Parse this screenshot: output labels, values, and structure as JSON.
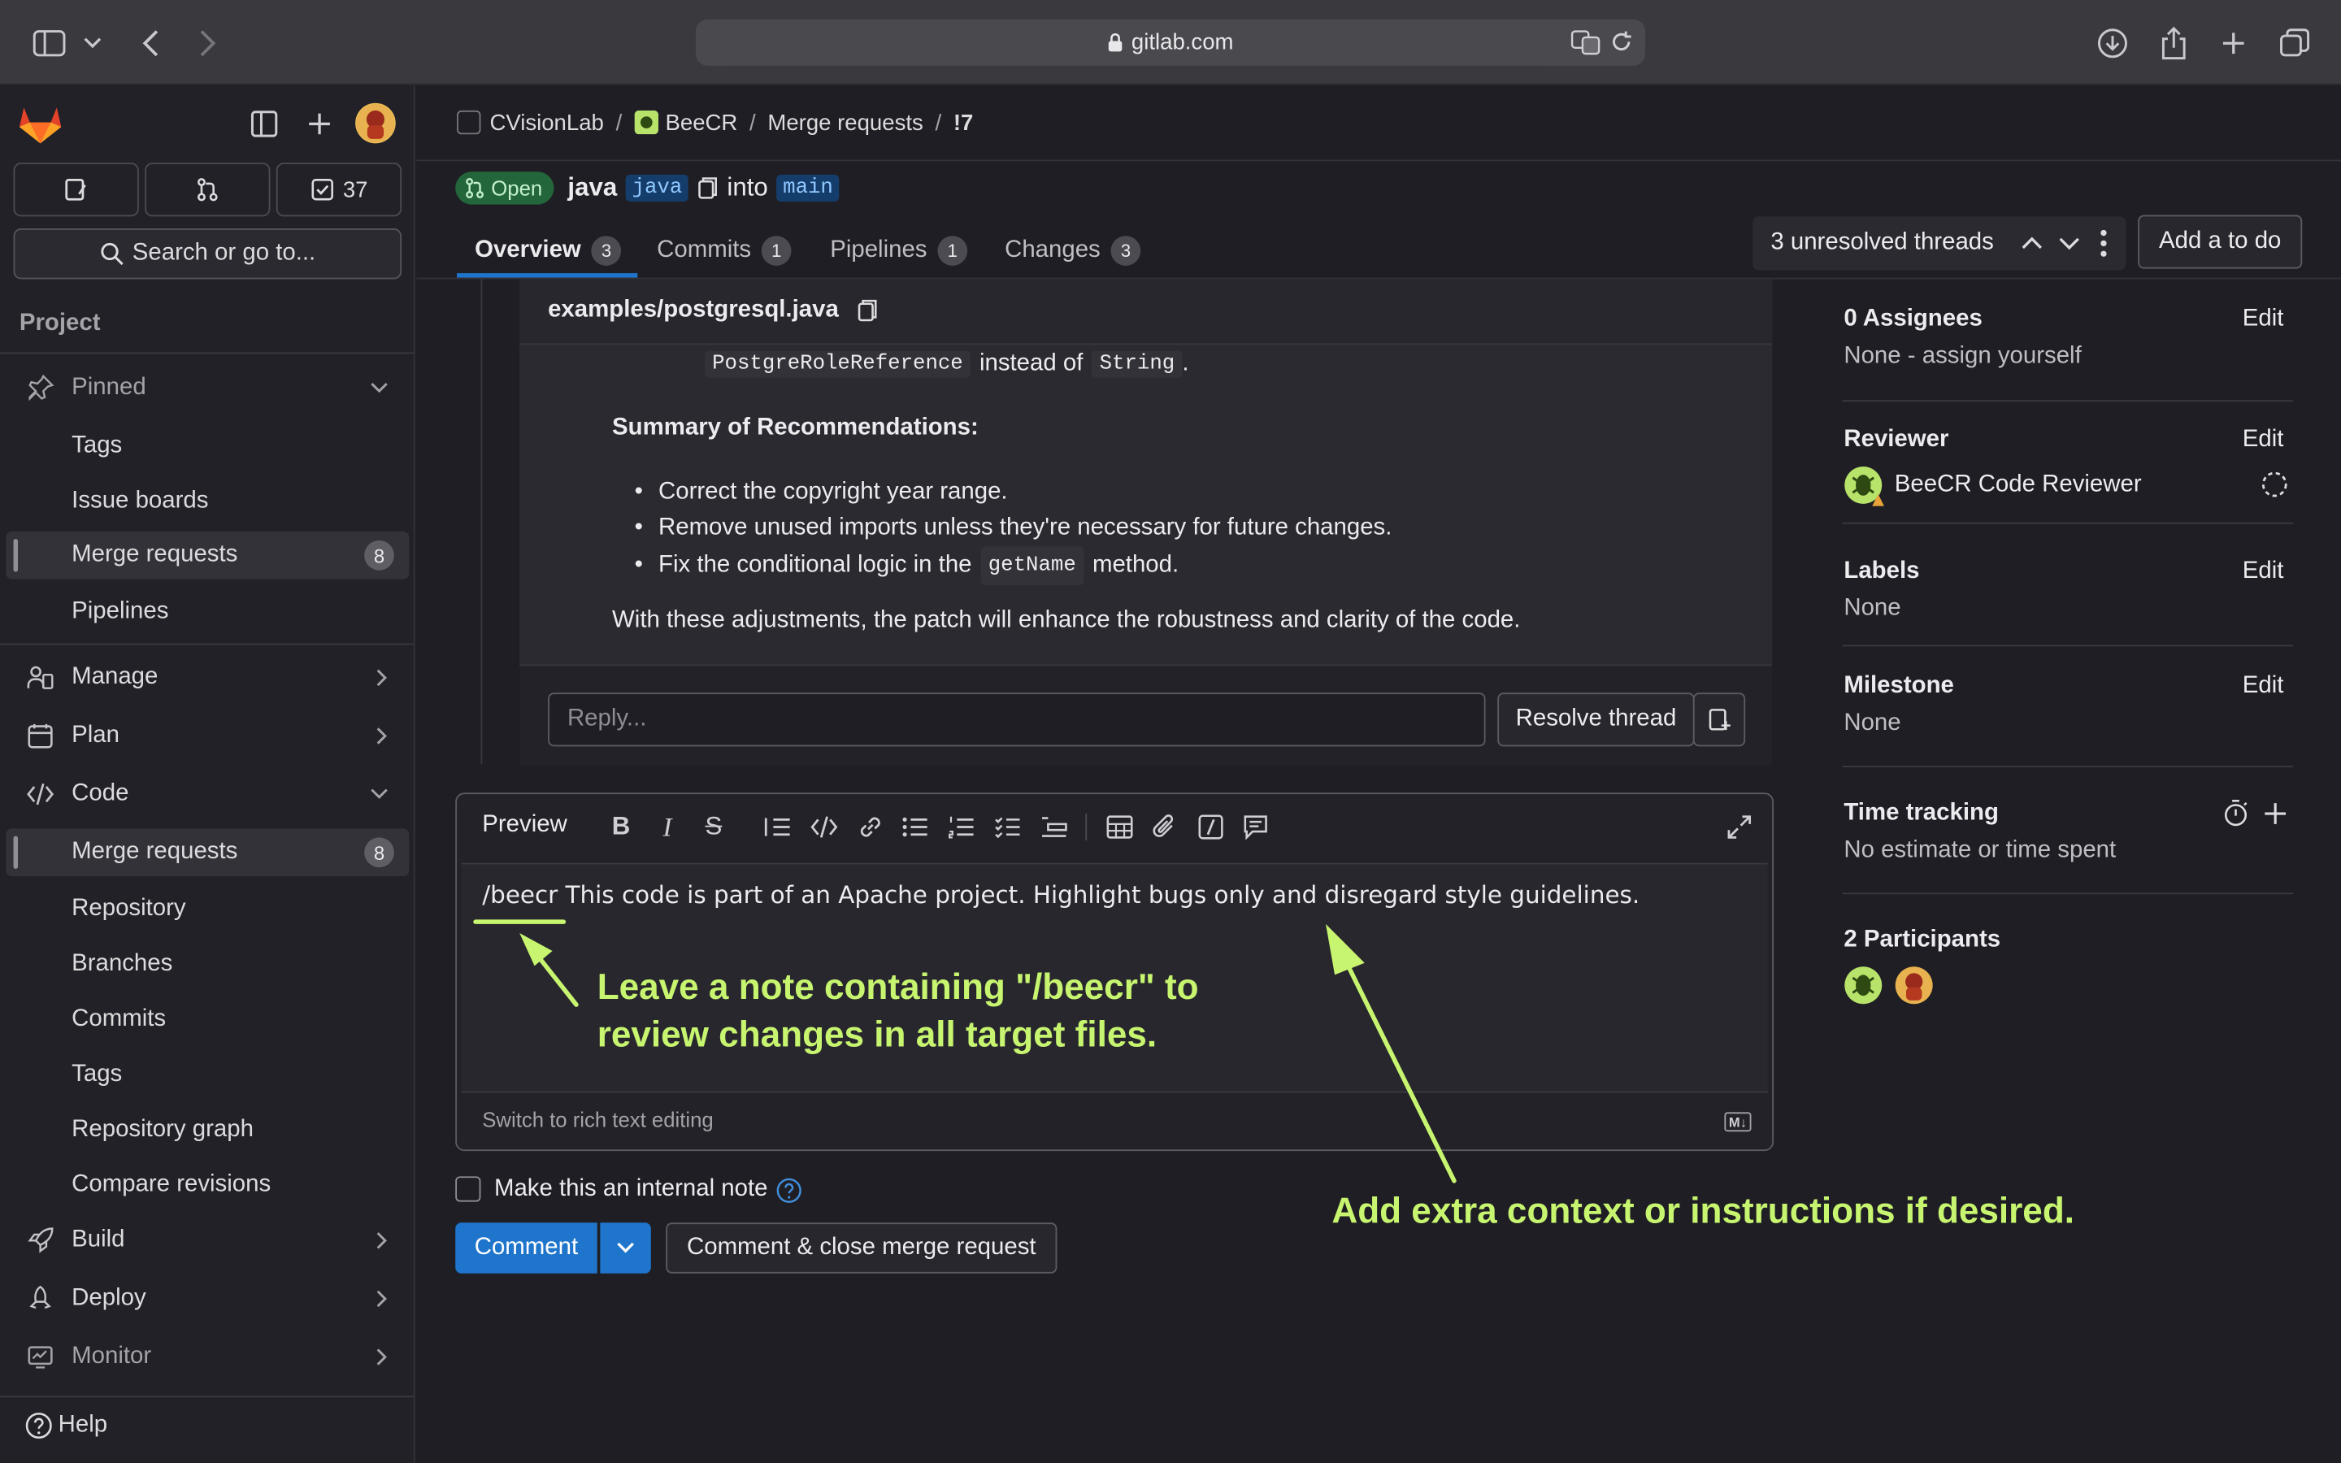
{
  "browser": {
    "url": "gitlab.com"
  },
  "sidebar": {
    "todo_count": "37",
    "search_label": "Search or go to...",
    "section_title": "Project",
    "pinned_label": "Pinned",
    "pinned_items": [
      {
        "label": "Tags"
      },
      {
        "label": "Issue boards"
      },
      {
        "label": "Merge requests",
        "count": "8"
      },
      {
        "label": "Pipelines"
      }
    ],
    "groups": [
      {
        "label": "Manage"
      },
      {
        "label": "Plan"
      },
      {
        "label": "Code"
      }
    ],
    "code_items": [
      {
        "label": "Merge requests",
        "count": "8"
      },
      {
        "label": "Repository"
      },
      {
        "label": "Branches"
      },
      {
        "label": "Commits"
      },
      {
        "label": "Tags"
      },
      {
        "label": "Repository graph"
      },
      {
        "label": "Compare revisions"
      }
    ],
    "bottom_groups": [
      {
        "label": "Build"
      },
      {
        "label": "Deploy"
      },
      {
        "label": "Monitor"
      }
    ],
    "help_label": "Help"
  },
  "breadcrumb": [
    "CVisionLab",
    "BeeCR",
    "Merge requests",
    "!7"
  ],
  "mr": {
    "status": "Open",
    "source_title": "java",
    "source_branch": "java",
    "into_label": "into",
    "target_branch": "main"
  },
  "tabs": [
    {
      "label": "Overview",
      "count": "3"
    },
    {
      "label": "Commits",
      "count": "1"
    },
    {
      "label": "Pipelines",
      "count": "1"
    },
    {
      "label": "Changes",
      "count": "3"
    }
  ],
  "threads": {
    "label": "3 unresolved threads",
    "todo_button": "Add a to do"
  },
  "discussion": {
    "file_path": "examples/postgresql.java",
    "snippet_code1": "PostgreRoleReference",
    "snippet_text1": "instead of",
    "snippet_code2": "String",
    "snippet_period": ".",
    "summary_heading": "Summary of Recommendations:",
    "bullets": [
      {
        "text": "Correct the copyright year range."
      },
      {
        "text": "Remove unused imports unless they're necessary for future changes."
      }
    ],
    "bullet3_pre": "Fix the conditional logic in the",
    "bullet3_code": "getName",
    "bullet3_post": "method.",
    "closing": "With these adjustments, the patch will enhance the robustness and clarity of the code.",
    "reply_placeholder": "Reply...",
    "resolve_button": "Resolve thread"
  },
  "editor": {
    "preview_tab": "Preview",
    "content": "/beecr This code is part of an Apache project. Highlight bugs only and disregard style guidelines.",
    "switch_label": "Switch to rich text editing",
    "md_badge": "M↓"
  },
  "internal_note_label": "Make this an internal note",
  "comment_button": "Comment",
  "close_button": "Comment & close merge request",
  "annotations": {
    "note1_line1": "Leave a note containing \"/beecr\" to",
    "note1_line2": "review changes in all target files.",
    "note2": "Add extra context or instructions if desired."
  },
  "right_sidebar": {
    "assignees_title": "0 Assignees",
    "assignees_value": "None - assign yourself",
    "reviewer_title": "Reviewer",
    "reviewer_name": "BeeCR Code Reviewer",
    "labels_title": "Labels",
    "labels_value": "None",
    "milestone_title": "Milestone",
    "milestone_value": "None",
    "time_title": "Time tracking",
    "time_value": "No estimate or time spent",
    "participants_title": "2 Participants",
    "edit_label": "Edit"
  },
  "colors": {
    "accent_blue": "#1f75cb",
    "open_green": "#24663b",
    "annotation": "#c7f56f",
    "bg": "#1f1e24"
  }
}
